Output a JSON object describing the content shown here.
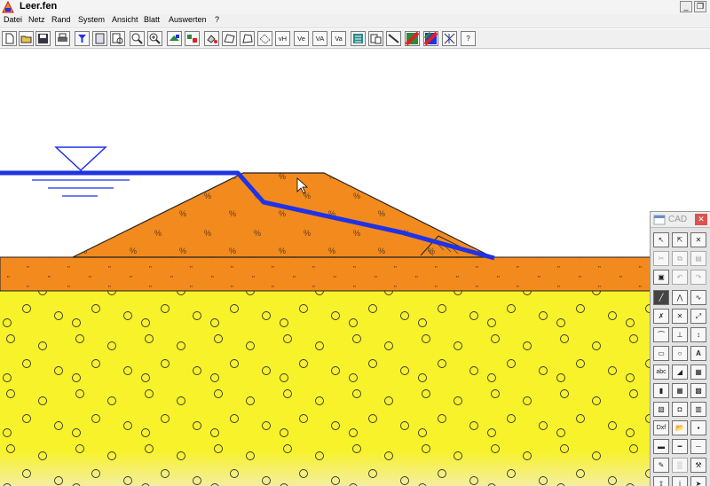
{
  "window": {
    "title": "Leer.fen"
  },
  "menu": [
    "Datei",
    "Netz",
    "Rand",
    "System",
    "Ansicht",
    "Blatt",
    "Auswerten",
    "?"
  ],
  "toolbar": {
    "text_buttons": [
      "vH",
      "Ve",
      "VA",
      "Va"
    ],
    "help": "?"
  },
  "drawing": {
    "embankment_symbol": "%",
    "clay_symbol": "\"",
    "sand_symbol": "o",
    "colors": {
      "embankment": "#f28a1e",
      "clay_layer": "#f28a1e",
      "sand_layer": "#f7f22a",
      "phreatic_line": "#1f32e6",
      "outline": "#222222"
    }
  },
  "cad_panel": {
    "title": "CAD",
    "close": "✕",
    "buttons": [
      "A",
      "abc",
      "Dxf",
      "i"
    ]
  }
}
